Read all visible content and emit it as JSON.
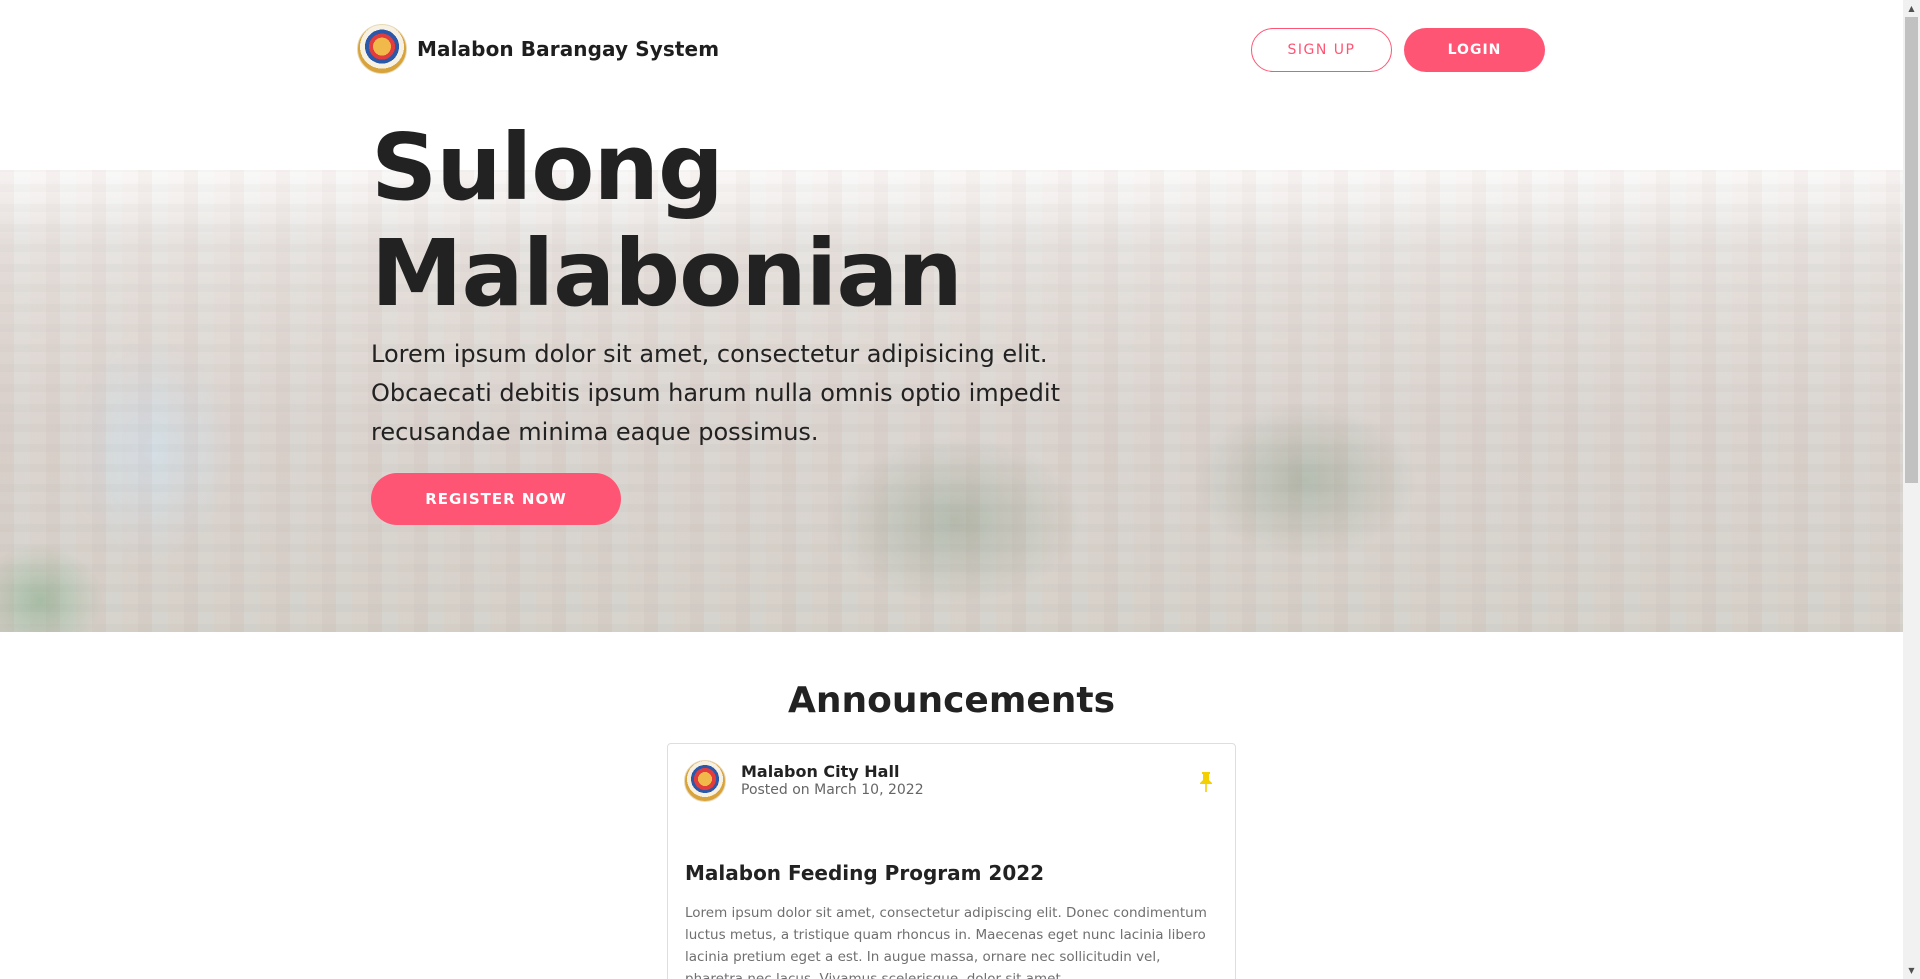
{
  "navbar": {
    "brand_name": "Malabon Barangay System",
    "signup_label": "SIGN UP",
    "login_label": "LOGIN"
  },
  "hero": {
    "title_line1": "Sulong",
    "title_line2": "Malabonian",
    "text": "Lorem ipsum dolor sit amet, consectetur adipisicing elit. Obcaecati debitis ipsum harum nulla omnis optio impedit recusandae minima eaque possimus.",
    "register_label": "REGISTER NOW"
  },
  "announcements": {
    "heading": "Announcements",
    "items": [
      {
        "author": "Malabon City Hall",
        "date": "Posted on March 10, 2022",
        "pinned": true,
        "title": "Malabon Feeding Program 2022",
        "body": "Lorem ipsum dolor sit amet, consectetur adipiscing elit. Donec condimentum luctus metus, a tristique quam rhoncus in. Maecenas eget nunc lacinia libero lacinia pretium eget a est. In augue massa, ornare nec sollicitudin vel, pharetra nec lacus. Vivamus scelerisque, dolor sit amet"
      }
    ]
  },
  "colors": {
    "accent": "#ff5574",
    "pin": "#f5d000",
    "text": "#222222"
  },
  "icons": {
    "brand": "malabon-seal-icon",
    "pin": "pin-icon"
  }
}
